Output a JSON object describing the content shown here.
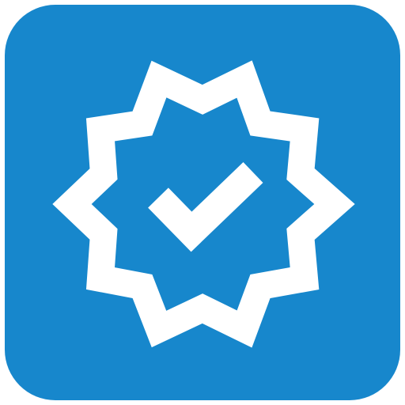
{
  "app_icon": {
    "icon": "verified-badge-icon",
    "background_color": "#1787CC",
    "foreground_color": "#FFFFFF"
  }
}
